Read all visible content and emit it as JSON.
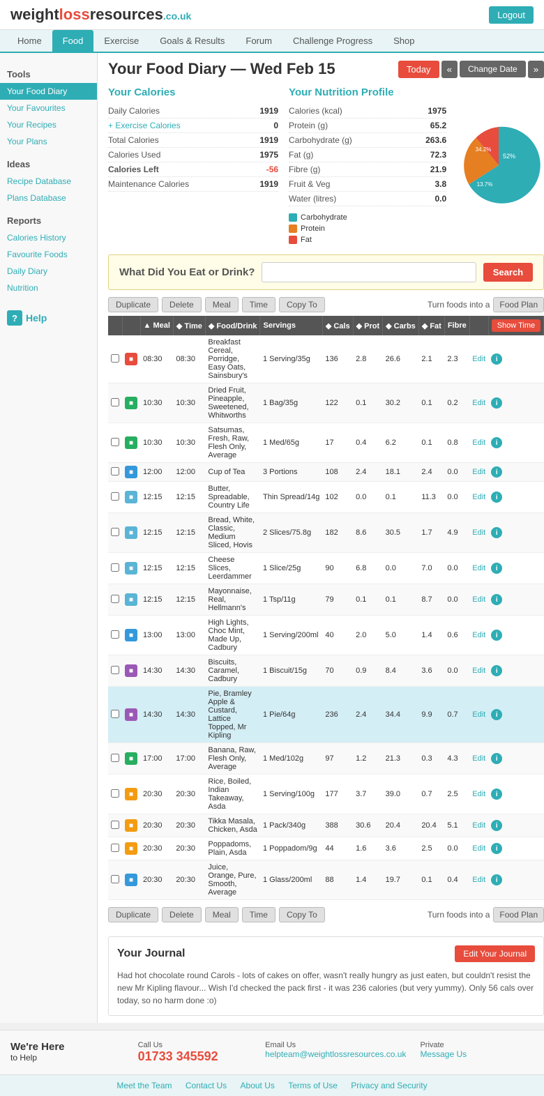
{
  "header": {
    "logo_weight": "weight",
    "logo_loss": "loss",
    "logo_resources": "resources",
    "logo_couk": ".co.uk",
    "logout_label": "Logout"
  },
  "nav": {
    "items": [
      {
        "label": "Home",
        "active": false
      },
      {
        "label": "Food",
        "active": true
      },
      {
        "label": "Exercise",
        "active": false
      },
      {
        "label": "Goals & Results",
        "active": false
      },
      {
        "label": "Forum",
        "active": false
      },
      {
        "label": "Challenge Progress",
        "active": false
      },
      {
        "label": "Shop",
        "active": false
      }
    ]
  },
  "sidebar": {
    "tools_label": "Tools",
    "items_tools": [
      {
        "label": "Your Food Diary",
        "active": true
      },
      {
        "label": "Your Favourites",
        "active": false
      },
      {
        "label": "Your Recipes",
        "active": false
      },
      {
        "label": "Your Plans",
        "active": false
      }
    ],
    "ideas_label": "Ideas",
    "items_ideas": [
      {
        "label": "Recipe Database",
        "active": false
      },
      {
        "label": "Plans Database",
        "active": false
      }
    ],
    "reports_label": "Reports",
    "items_reports": [
      {
        "label": "Calories History",
        "active": false
      },
      {
        "label": "Favourite Foods",
        "active": false
      },
      {
        "label": "Daily Diary",
        "active": false
      },
      {
        "label": "Nutrition",
        "active": false
      }
    ],
    "help_label": "Help"
  },
  "page_title": "Your Food Diary — Wed Feb 15",
  "date_nav": {
    "today": "Today",
    "prev": "«",
    "change_date": "Change Date",
    "next": "»"
  },
  "calories": {
    "title": "Your Calories",
    "rows": [
      {
        "label": "Daily Calories",
        "value": "1919"
      },
      {
        "label": "+ Exercise Calories",
        "value": "0"
      },
      {
        "label": "Total Calories",
        "value": "1919"
      },
      {
        "label": "Calories Used",
        "value": "1975"
      },
      {
        "label": "Calories Left",
        "value": "-56"
      },
      {
        "label": "Maintenance Calories",
        "value": "1919"
      }
    ]
  },
  "nutrition": {
    "title": "Your Nutrition Profile",
    "rows": [
      {
        "label": "Calories (kcal)",
        "value": "1975"
      },
      {
        "label": "Protein (g)",
        "value": "65.2"
      },
      {
        "label": "Carbohydrate (g)",
        "value": "263.6"
      },
      {
        "label": "Fat (g)",
        "value": "72.3"
      },
      {
        "label": "Fibre (g)",
        "value": "21.9"
      },
      {
        "label": "Fruit & Veg",
        "value": "3.8"
      },
      {
        "label": "Water (litres)",
        "value": "0.0"
      }
    ],
    "legend": [
      {
        "label": "Carbohydrate",
        "color": "#2eadb5"
      },
      {
        "label": "Protein",
        "color": "#e67e22"
      },
      {
        "label": "Fat",
        "color": "#e74c3c"
      }
    ],
    "chart": {
      "carb_pct": 52,
      "carb_label": "52%",
      "protein_pct": 13.7,
      "protein_label": "13.7%",
      "fat_pct": 34.2,
      "fat_label": "34.2%"
    }
  },
  "search": {
    "label": "What Did You Eat or Drink?",
    "placeholder": "",
    "button": "Search"
  },
  "toolbar": {
    "duplicate": "Duplicate",
    "delete": "Delete",
    "meal": "Meal",
    "time": "Time",
    "copy_to": "Copy To",
    "turn_foods": "Turn foods into a",
    "food_plan": "Food Plan",
    "show_time": "Show Time"
  },
  "table": {
    "headers": [
      "",
      "",
      "▲ Meal",
      "◆ Time",
      "◆ Food/Drink",
      "Servings",
      "◆ Cals",
      "◆ Prot",
      "◆ Carbs",
      "◆ Fat",
      "Fibre",
      "",
      ""
    ],
    "rows": [
      {
        "icon_type": "breakfast",
        "icon_sym": "🔒",
        "time": "08:30",
        "food": "Breakfast Cereal, Porridge, Easy Oats, Sainsbury's",
        "servings": "1 Serving/35g",
        "cals": "136",
        "prot": "2.8",
        "carbs": "26.6",
        "fat": "2.1",
        "fibre": "2.3",
        "highlighted": false
      },
      {
        "icon_type": "snack",
        "icon_sym": "▶",
        "time": "10:30",
        "food": "Dried Fruit, Pineapple, Sweetened, Whitworths",
        "servings": "1 Bag/35g",
        "cals": "122",
        "prot": "0.1",
        "carbs": "30.2",
        "fat": "0.1",
        "fibre": "0.2",
        "highlighted": false
      },
      {
        "icon_type": "snack",
        "icon_sym": "▶",
        "time": "10:30",
        "food": "Satsumas, Fresh, Raw, Flesh Only, Average",
        "servings": "1 Med/65g",
        "cals": "17",
        "prot": "0.4",
        "carbs": "6.2",
        "fat": "0.1",
        "fibre": "0.8",
        "highlighted": false
      },
      {
        "icon_type": "drink",
        "icon_sym": "☕",
        "time": "12:00",
        "food": "Cup of Tea",
        "servings": "3 Portions",
        "cals": "108",
        "prot": "2.4",
        "carbs": "18.1",
        "fat": "2.4",
        "fibre": "0.0",
        "highlighted": false
      },
      {
        "icon_type": "lunch",
        "icon_sym": "🍞",
        "time": "12:15",
        "food": "Butter, Spreadable, Country Life",
        "servings": "Thin Spread/14g",
        "cals": "102",
        "prot": "0.0",
        "carbs": "0.1",
        "fat": "11.3",
        "fibre": "0.0",
        "highlighted": false
      },
      {
        "icon_type": "lunch",
        "icon_sym": "🍞",
        "time": "12:15",
        "food": "Bread, White, Classic, Medium Sliced, Hovis",
        "servings": "2 Slices/75.8g",
        "cals": "182",
        "prot": "8.6",
        "carbs": "30.5",
        "fat": "1.7",
        "fibre": "4.9",
        "highlighted": false
      },
      {
        "icon_type": "lunch",
        "icon_sym": "🧀",
        "time": "12:15",
        "food": "Cheese Slices, Leerdammer",
        "servings": "1 Slice/25g",
        "cals": "90",
        "prot": "6.8",
        "carbs": "0.0",
        "fat": "7.0",
        "fibre": "0.0",
        "highlighted": false
      },
      {
        "icon_type": "lunch",
        "icon_sym": "🥄",
        "time": "12:15",
        "food": "Mayonnaise, Real, Hellmann's",
        "servings": "1 Tsp/11g",
        "cals": "79",
        "prot": "0.1",
        "carbs": "0.1",
        "fat": "8.7",
        "fibre": "0.0",
        "highlighted": false
      },
      {
        "icon_type": "drink",
        "icon_sym": "🍫",
        "time": "13:00",
        "food": "High Lights, Choc Mint, Made Up, Cadbury",
        "servings": "1 Serving/200ml",
        "cals": "40",
        "prot": "2.0",
        "carbs": "5.0",
        "fat": "1.4",
        "fibre": "0.6",
        "highlighted": false
      },
      {
        "icon_type": "sweet",
        "icon_sym": "🍪",
        "time": "14:30",
        "food": "Biscuits, Caramel, Cadbury",
        "servings": "1 Biscuit/15g",
        "cals": "70",
        "prot": "0.9",
        "carbs": "8.4",
        "fat": "3.6",
        "fibre": "0.0",
        "highlighted": false
      },
      {
        "icon_type": "sweet",
        "icon_sym": "🥧",
        "time": "14:30",
        "food": "Pie, Bramley Apple & Custard, Lattice Topped, Mr Kipling",
        "servings": "1 Pie/64g",
        "cals": "236",
        "prot": "2.4",
        "carbs": "34.4",
        "fat": "9.9",
        "fibre": "0.7",
        "highlighted": true
      },
      {
        "icon_type": "snack",
        "icon_sym": "🍌",
        "time": "17:00",
        "food": "Banana, Raw, Flesh Only, Average",
        "servings": "1 Med/102g",
        "cals": "97",
        "prot": "1.2",
        "carbs": "21.3",
        "fat": "0.3",
        "fibre": "4.3",
        "highlighted": false
      },
      {
        "icon_type": "dinner",
        "icon_sym": "🍛",
        "time": "20:30",
        "food": "Rice, Boiled, Indian Takeaway, Asda",
        "servings": "1 Serving/100g",
        "cals": "177",
        "prot": "3.7",
        "carbs": "39.0",
        "fat": "0.7",
        "fibre": "2.5",
        "highlighted": false
      },
      {
        "icon_type": "dinner",
        "icon_sym": "🍗",
        "time": "20:30",
        "food": "Tikka Masala, Chicken, Asda",
        "servings": "1 Pack/340g",
        "cals": "388",
        "prot": "30.6",
        "carbs": "20.4",
        "fat": "20.4",
        "fibre": "5.1",
        "highlighted": false
      },
      {
        "icon_type": "dinner",
        "icon_sym": "🫓",
        "time": "20:30",
        "food": "Poppadoms, Plain, Asda",
        "servings": "1 Poppadom/9g",
        "cals": "44",
        "prot": "1.6",
        "carbs": "3.6",
        "fat": "2.5",
        "fibre": "0.0",
        "highlighted": false
      },
      {
        "icon_type": "drink",
        "icon_sym": "🍊",
        "time": "20:30",
        "food": "Juice, Orange, Pure, Smooth, Average",
        "servings": "1 Glass/200ml",
        "cals": "88",
        "prot": "1.4",
        "carbs": "19.7",
        "fat": "0.1",
        "fibre": "0.4",
        "highlighted": false
      }
    ]
  },
  "journal": {
    "title": "Your Journal",
    "edit_button": "Edit Your Journal",
    "text": "Had hot chocolate round Carols - lots of cakes on offer, wasn't really hungry as just eaten, but couldn't resist the new Mr Kipling flavour... Wish I'd checked the pack first - it was 236 calories (but very yummy). Only 56 cals over today, so no harm done :o)"
  },
  "footer_help": {
    "title": "We're Here",
    "subtitle": "to Help",
    "call_label": "Call Us",
    "call_number": "01733 345592",
    "email_label": "Email Us",
    "email_address": "helpteam@weightlossresources.co.uk",
    "private_label": "Private",
    "message_link": "Message Us"
  },
  "footer_links": [
    "Meet the Team",
    "Contact Us",
    "About Us",
    "Terms of Use",
    "Privacy and Security"
  ]
}
